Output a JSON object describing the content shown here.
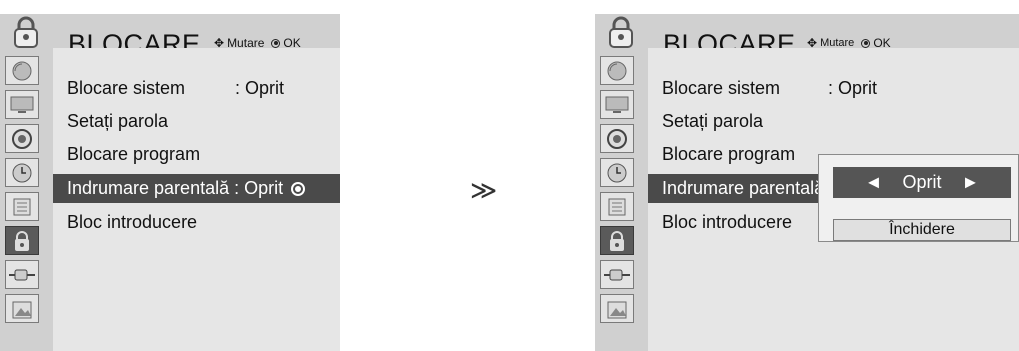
{
  "left": {
    "title": "BLOCARE",
    "hint_move": "Mutare",
    "hint_ok": "OK",
    "items": [
      {
        "label": "Blocare sistem",
        "value": ": Oprit"
      },
      {
        "label": "Setați parola",
        "value": ""
      },
      {
        "label": "Blocare program",
        "value": ""
      },
      {
        "label": "Indrumare parentală",
        "value": ": Oprit"
      },
      {
        "label": "Bloc introducere",
        "value": ""
      }
    ]
  },
  "step_arrow": "≫",
  "right": {
    "title": "BLOCARE",
    "hint_move": "Mutare",
    "hint_ok": "OK",
    "items": [
      {
        "label": "Blocare sistem",
        "value": ": Oprit"
      },
      {
        "label": "Setați parola",
        "value": ""
      },
      {
        "label": "Blocare program",
        "value": ""
      },
      {
        "label": "Indrumare parentală",
        "value": ""
      },
      {
        "label": "Bloc introducere",
        "value": ""
      }
    ],
    "popup": {
      "left_arrow": "◄",
      "option": "Oprit",
      "right_arrow": "►",
      "close_label": "Închidere"
    }
  },
  "side_icons": [
    "satellite-icon",
    "screen-icon",
    "audio-icon",
    "clock-icon",
    "settings-icon",
    "lock-icon",
    "input-plug-icon",
    "photo-icon"
  ]
}
